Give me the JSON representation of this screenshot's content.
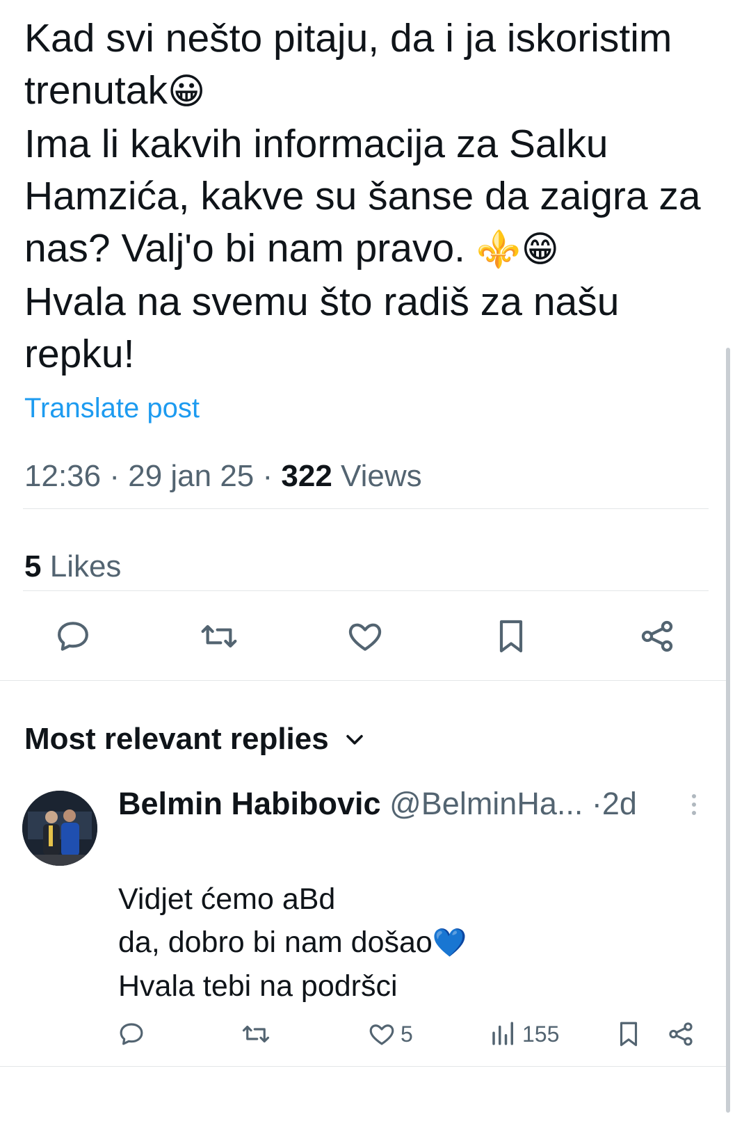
{
  "post": {
    "lines": [
      "Kad svi nešto pitaju, da i ja iskoristim",
      "trenutak",
      "Ima li kakvih informacija za Salku",
      "Hamzića, kakve su šanse da zaigra za",
      "nas? Valj'o bi nam pravo.",
      "Hvala na svemu što radiš za našu",
      "repku!"
    ],
    "emoji_1": "😀",
    "emoji_2": "⚜️",
    "emoji_3": "😁",
    "translate_label": "Translate post",
    "time": "12:36",
    "date": "29 jan 25",
    "views_count": "322",
    "views_label": "Views",
    "likes_count": "5",
    "likes_label": "Likes"
  },
  "actions": {
    "icons": [
      "reply-icon",
      "repost-icon",
      "like-icon",
      "bookmark-icon",
      "share-icon"
    ]
  },
  "replies_header": {
    "label": "Most relevant replies"
  },
  "reply": {
    "name": "Belmin Habibovic",
    "handle": "@BelminHa...",
    "separator": "·",
    "time": "2d",
    "lines": [
      "Vidjet ćemo aBd",
      "da, dobro bi nam došao",
      "Hvala tebi na podršci"
    ],
    "heart_emoji": "💙",
    "likes": "5",
    "views": "155"
  },
  "colors": {
    "text": "#0f1419",
    "secondary": "#536471",
    "link": "#1d9bf0",
    "divider": "#e3e6e8"
  }
}
